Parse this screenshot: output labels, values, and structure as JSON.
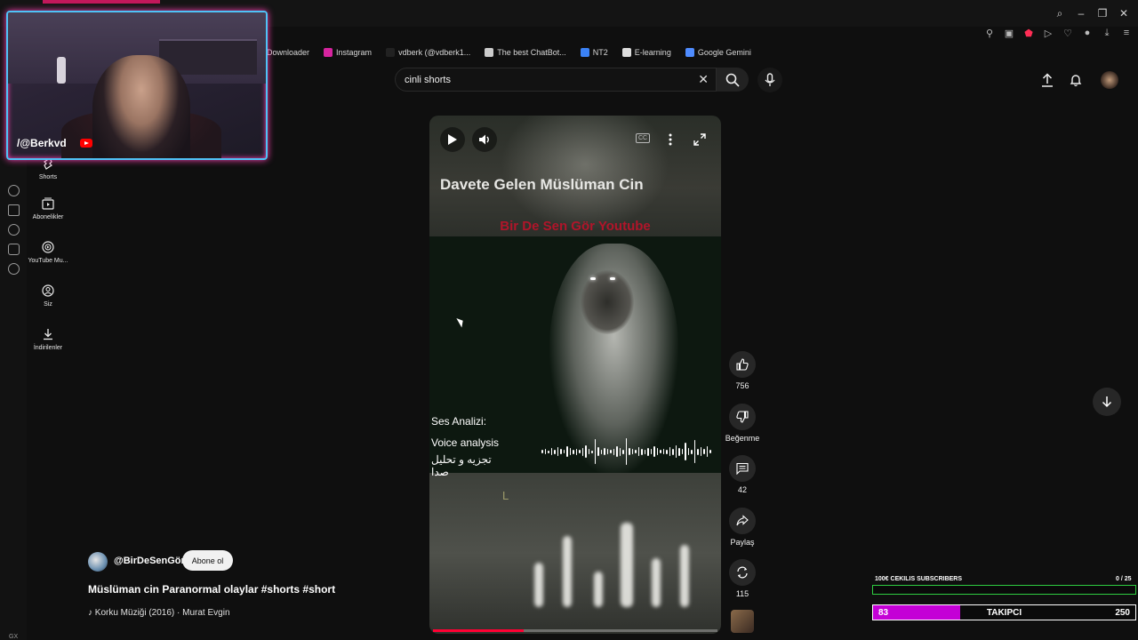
{
  "bookmarks": [
    {
      "label": "Downloader",
      "icon": "downloader-icon",
      "color": "#3a3a3a"
    },
    {
      "label": "Instagram",
      "icon": "instagram-icon",
      "color": "#d6249f"
    },
    {
      "label": "vdberk (@vdberk1...",
      "icon": "tiktok-icon",
      "color": "#222222"
    },
    {
      "label": "The best ChatBot...",
      "icon": "chatbot-icon",
      "color": "#cccccc"
    },
    {
      "label": "NT2",
      "icon": "nt2-icon",
      "color": "#3b82f6"
    },
    {
      "label": "E-learning",
      "icon": "elearning-icon",
      "color": "#dddddd"
    },
    {
      "label": "Google Gemini",
      "icon": "gemini-icon",
      "color": "#4f8cff"
    }
  ],
  "guide": [
    {
      "label": "Shorts",
      "icon": "shorts-icon"
    },
    {
      "label": "Abonelikler",
      "icon": "subscriptions-icon"
    },
    {
      "label": "YouTube Mu...",
      "icon": "youtube-music-icon"
    },
    {
      "label": "Siz",
      "icon": "you-icon"
    },
    {
      "label": "İndirilenler",
      "icon": "downloads-icon"
    }
  ],
  "opera": {
    "gx_label": "GX",
    "more_label": "•••"
  },
  "search": {
    "value": "cinli shorts"
  },
  "video": {
    "title_overlay": "Davete Gelen Müslüman Cin",
    "subtitle_overlay": "Bir De Sen Gör Youtube",
    "ses_analizi": "Ses Analizi:",
    "voice_analysis": "Voice analysis",
    "arabic_text": "تجزیه و تحلیل صدا",
    "letter": "L",
    "cc_label": "CC",
    "progress": 0.32
  },
  "actions": {
    "likes": "756",
    "dislike_label": "Beğenme",
    "comments": "42",
    "share_label": "Paylaş",
    "remix": "115"
  },
  "meta": {
    "channel": "@BirDeSenGör",
    "subscribe_label": "Abone ol",
    "title": "Müslüman cin Paranormal olaylar #shorts #short",
    "music": "♪ Korku Müziği (2016) · Murat Evgin"
  },
  "webcam": {
    "handle": "/@Berkvd"
  },
  "widgets": {
    "sub_goal_label": "100€ CEKILIS SUBSCRIBERS",
    "sub_goal_count": "0  / 25",
    "sub_progress": 0,
    "follower_value": "83",
    "follower_label": "TAKIPCI",
    "follower_goal": "250",
    "follower_progress": 0.332,
    "follower_color": "#c400d6"
  }
}
